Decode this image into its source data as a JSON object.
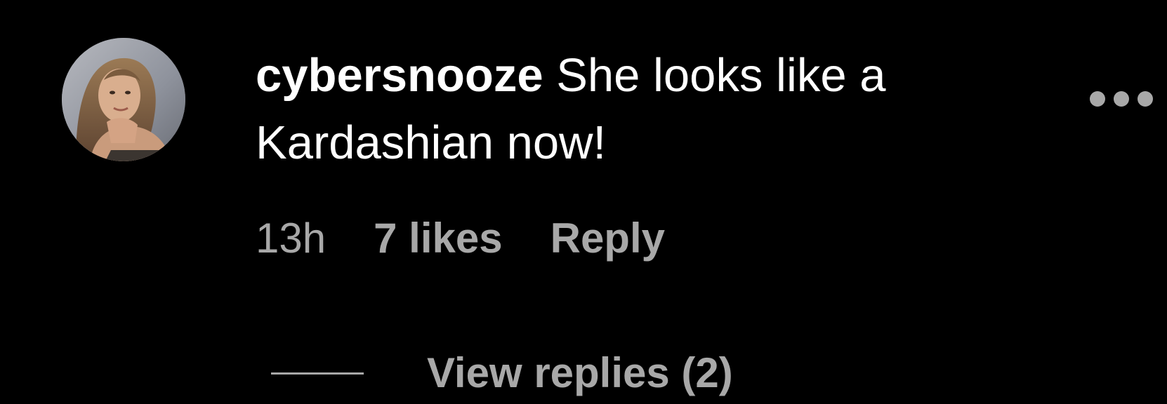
{
  "comment": {
    "username": "cybersnooze",
    "text": " She looks like a Kardashian now!",
    "time": "13h",
    "likes": "7 likes",
    "reply_label": "Reply",
    "more_icon": "more-horizontal-icon",
    "view_replies_label": "View replies (2)"
  },
  "colors": {
    "background": "#000000",
    "primary_text": "#ffffff",
    "secondary_text": "#a8a8a8"
  }
}
